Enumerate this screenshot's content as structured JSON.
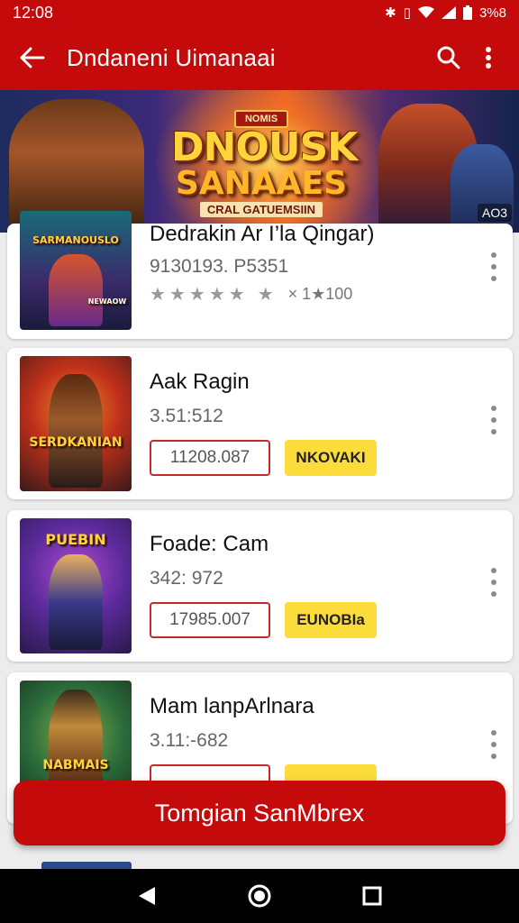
{
  "status_bar": {
    "time": "12:08",
    "battery": "3%8"
  },
  "app_bar": {
    "title": "Dndaneni Uimanaai"
  },
  "banner": {
    "badge": "NOMIS",
    "title_line1": "DNOUSK",
    "title_line2": "SANAAES",
    "subtitle": "CRAL GATUEMSIIN",
    "ad_tag": "AO3"
  },
  "games": [
    {
      "title": "Dedrakin Ar I’la Qingar)",
      "subtitle": "9130193. P5351",
      "rating_count": "× 1★100",
      "thumb_label": "SARMANOUSLO",
      "thumb_badge": "NEWAOW"
    },
    {
      "title": "Aak Ragin",
      "subtitle": "3.51:512",
      "price": "11208.087",
      "action": "NKOVAKI",
      "thumb_label": "SERDKANIAN"
    },
    {
      "title": "Foade: Cam",
      "subtitle": "342: 972",
      "price": "17985.007",
      "action": "EUNOBIa",
      "thumb_label": "PUEBIN"
    },
    {
      "title": "Mam lanpArlnara",
      "subtitle": "3.11:-682",
      "thumb_label": "NABMAIS"
    }
  ],
  "cta": {
    "label": "Tomgian SanMbrex"
  },
  "colors": {
    "primary": "#c40a0a",
    "accent_yellow": "#fcdc3a",
    "price_border": "#c7282a"
  }
}
